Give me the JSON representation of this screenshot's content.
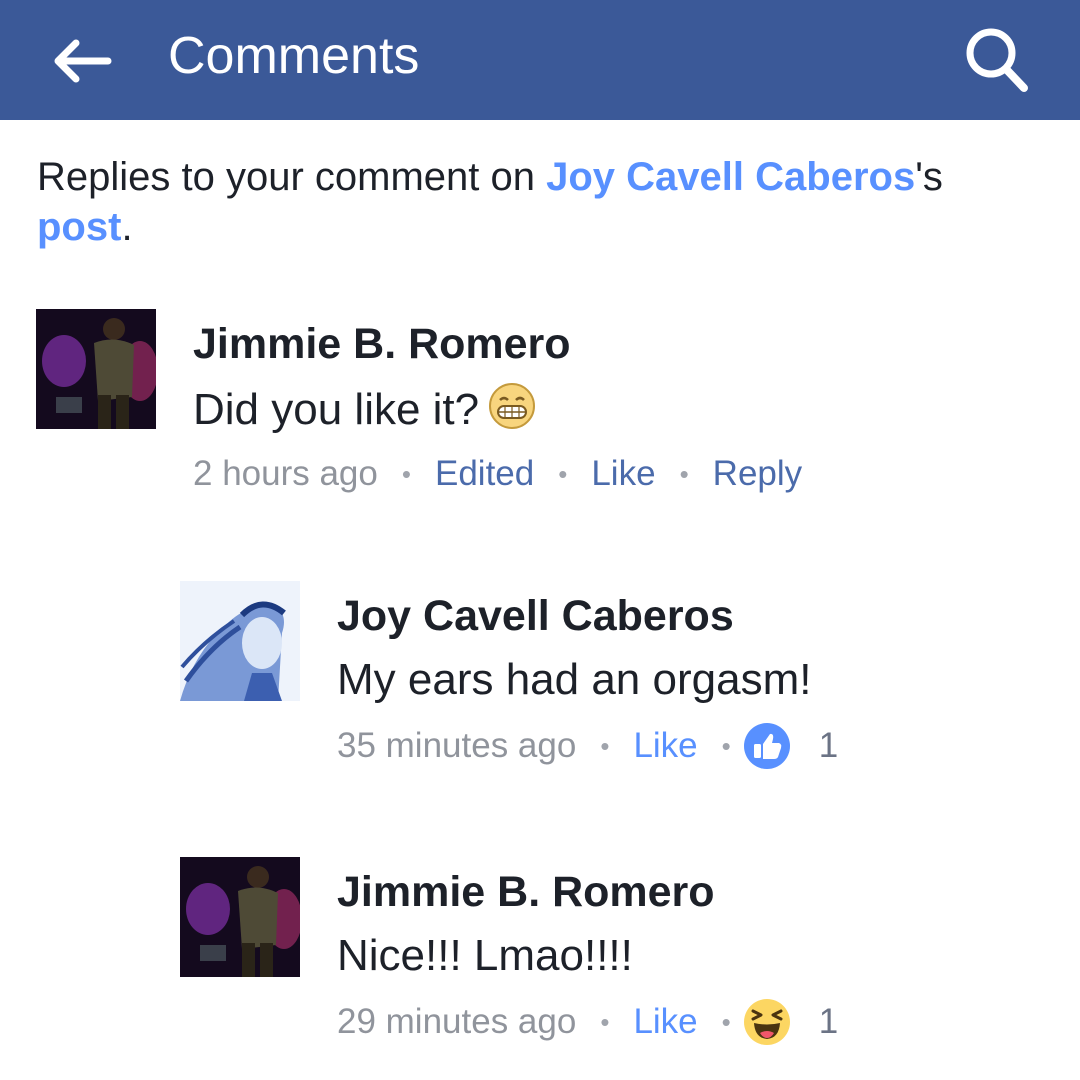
{
  "header": {
    "title": "Comments",
    "bg_color": "#3b5998",
    "back_icon": "back-arrow-icon",
    "search_icon": "search-icon"
  },
  "intro": {
    "prefix": "Replies to your comment on ",
    "author_link": "Joy Cavell Caberos",
    "possessive": "'s",
    "post_link": "post",
    "suffix": "."
  },
  "comments": [
    {
      "author": "Jimmie B. Romero",
      "text": "Did you like it?",
      "emoji": "grinning-face-icon",
      "time": "2 hours ago",
      "actions": [
        "Edited",
        "Like",
        "Reply"
      ]
    },
    {
      "author": "Joy Cavell Caberos",
      "text": "My ears had an orgasm!",
      "time": "35 minutes ago",
      "like": "Like",
      "reaction": "thumbs-up-icon",
      "reaction_count": "1"
    },
    {
      "author": "Jimmie B. Romero",
      "text": "Nice!!! Lmao!!!!",
      "time": "29 minutes ago",
      "like": "Like",
      "reaction": "laughing-face-icon",
      "reaction_count": "1"
    }
  ],
  "colors": {
    "link": "#5890ff",
    "action": "#4b6bab",
    "muted": "#90949c"
  }
}
